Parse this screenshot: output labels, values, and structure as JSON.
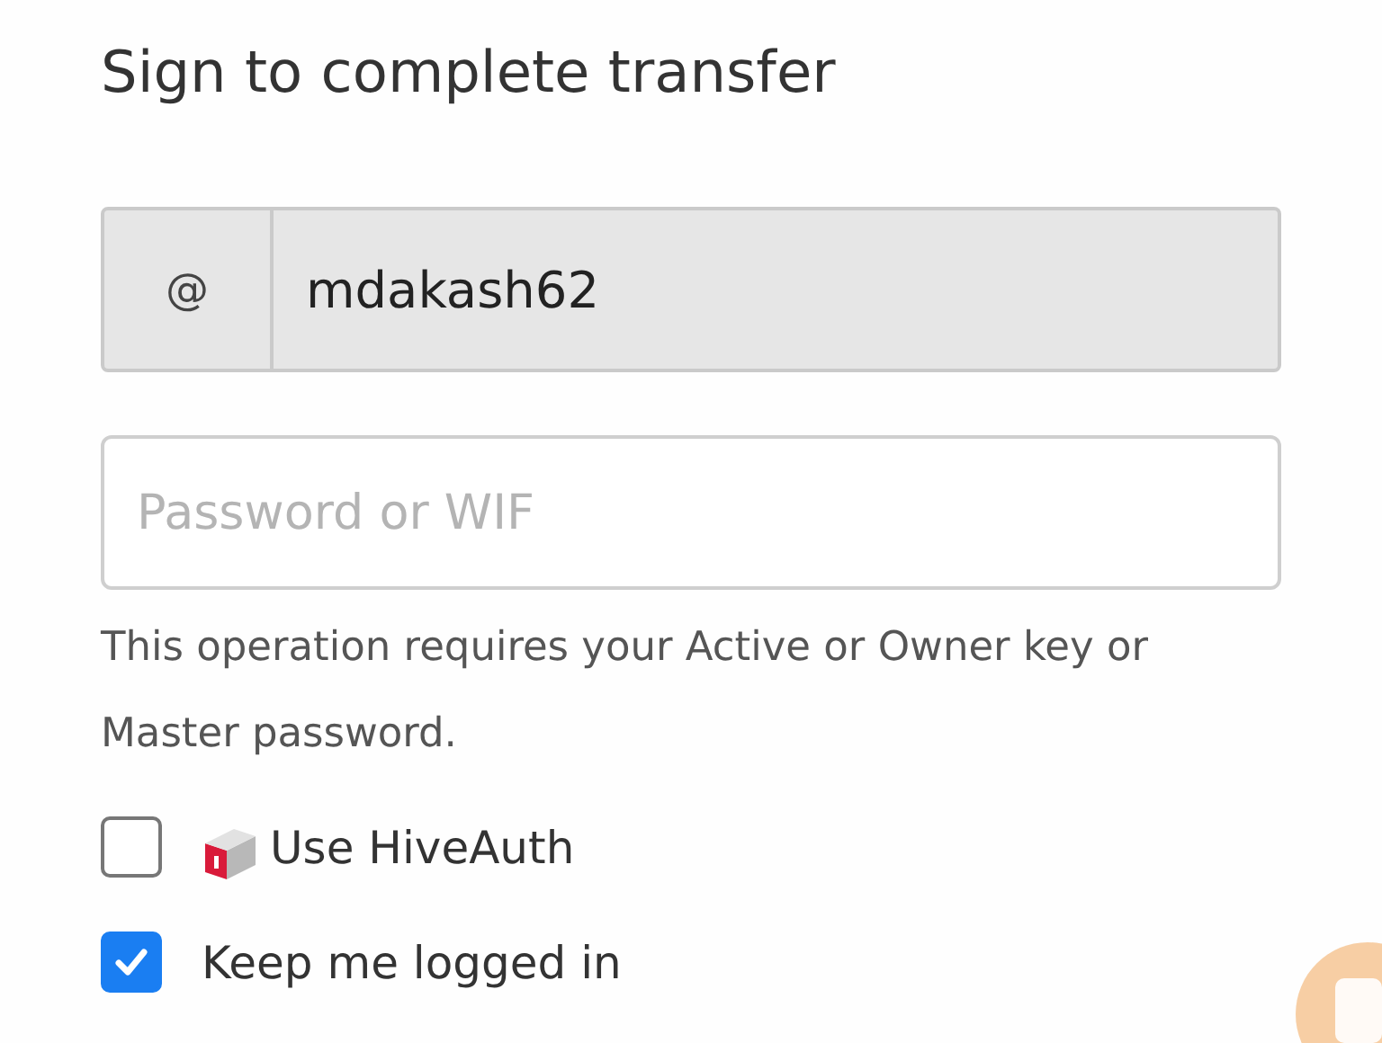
{
  "title": "Sign to complete transfer",
  "username": {
    "prefix": "@",
    "value": "mdakash62"
  },
  "password": {
    "placeholder": "Password or WIF"
  },
  "help_text": "This operation requires your Active or Owner key or Master password.",
  "options": [
    {
      "label": "Use HiveAuth",
      "checked": false,
      "kind": "hiveauth"
    },
    {
      "label": "Keep me logged in",
      "checked": true,
      "kind": "plain"
    }
  ]
}
